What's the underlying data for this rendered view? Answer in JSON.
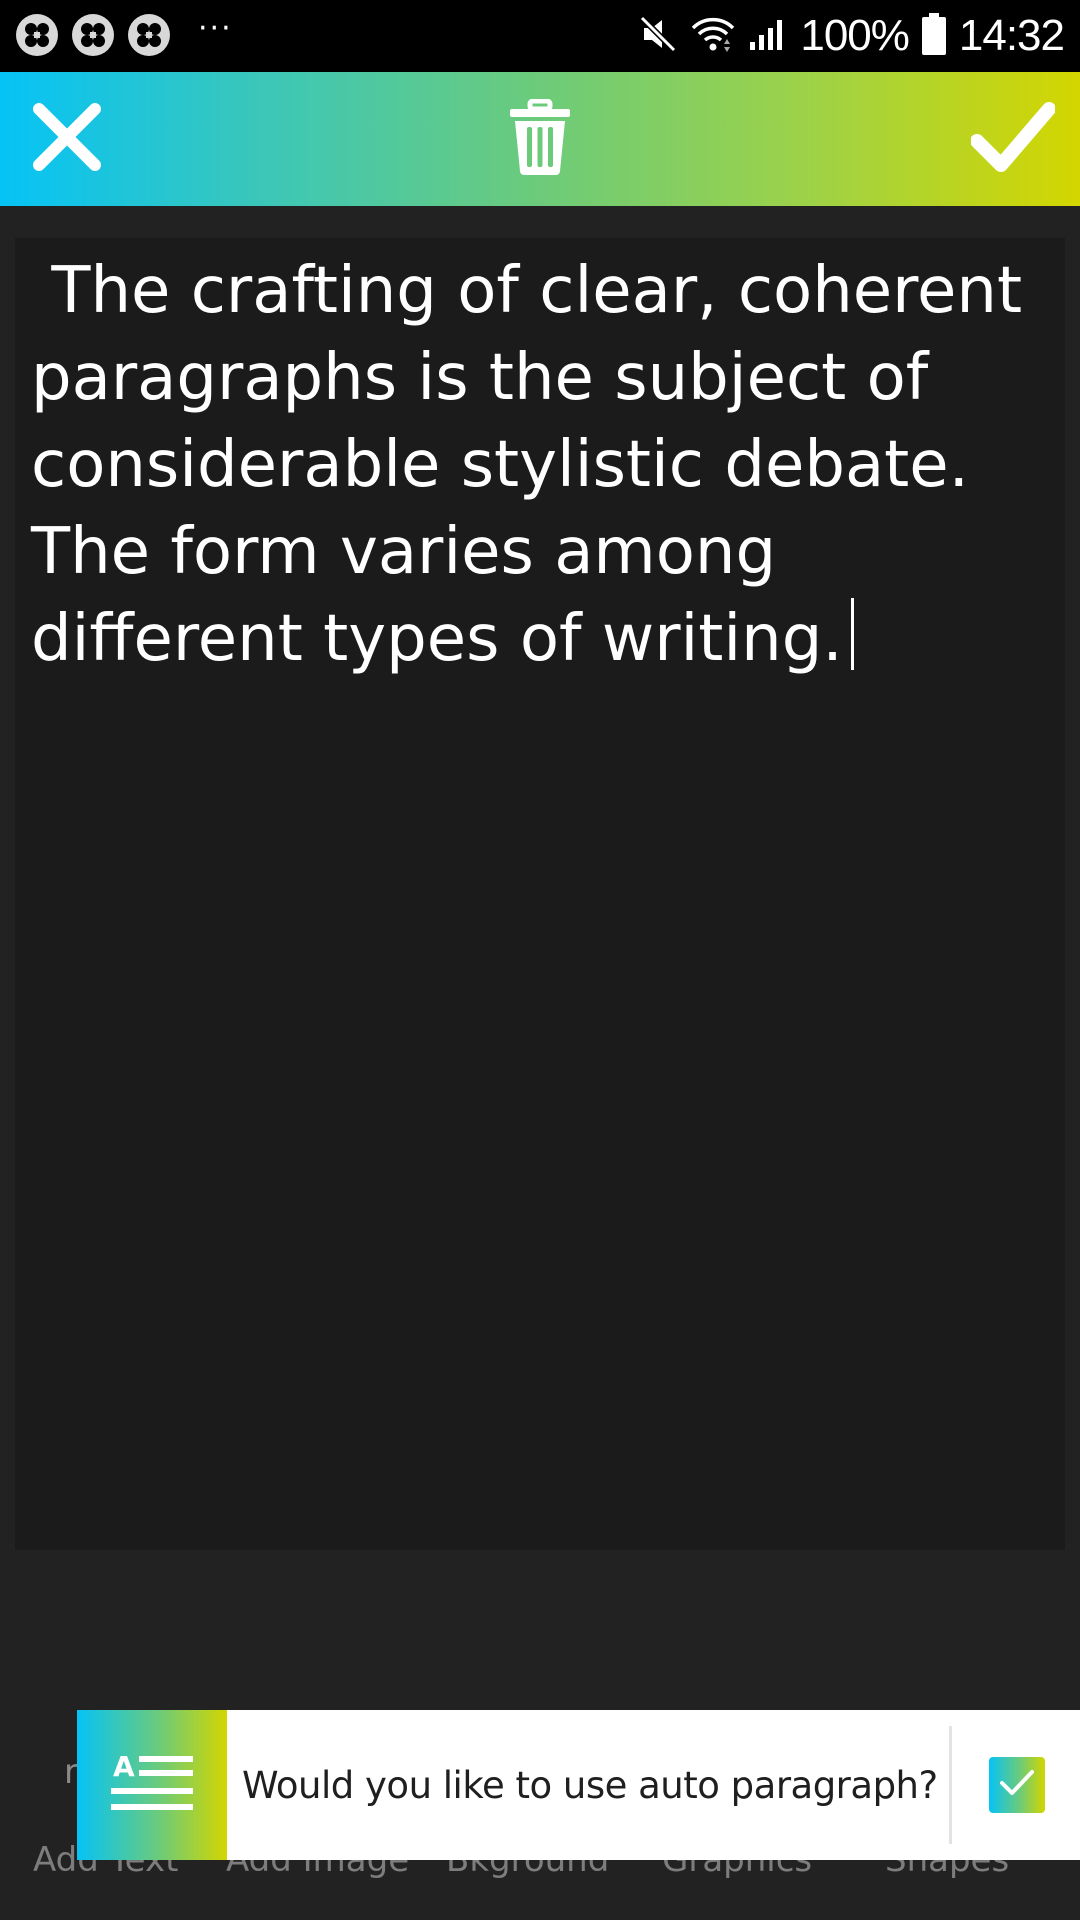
{
  "status_bar": {
    "notification_icons": [
      "app-icon",
      "app-icon",
      "app-icon"
    ],
    "overflow_indicator": "···",
    "icons": [
      "mute-icon",
      "wifi-icon",
      "signal-icon",
      "battery-icon"
    ],
    "battery": "100%",
    "time": "14:32"
  },
  "toolbar": {
    "close_icon": "close-icon",
    "delete_icon": "trash-icon",
    "confirm_icon": "check-icon",
    "gradient": [
      "#05c3f6",
      "#d3d600"
    ]
  },
  "editor": {
    "text": " The crafting of clear, coherent paragraphs is the subject of considerable stylistic debate. The form varies among different types of writing."
  },
  "bottom_tabs": {
    "peek": "r",
    "items": [
      "Add Text",
      "Add Image",
      "Bkground",
      "Graphics",
      "Shapes"
    ]
  },
  "auto_paragraph_prompt": {
    "icon": "paragraph-format-icon",
    "icon_letter": "A",
    "message": "Would you like to use auto paragraph?",
    "checkbox_checked": true
  }
}
